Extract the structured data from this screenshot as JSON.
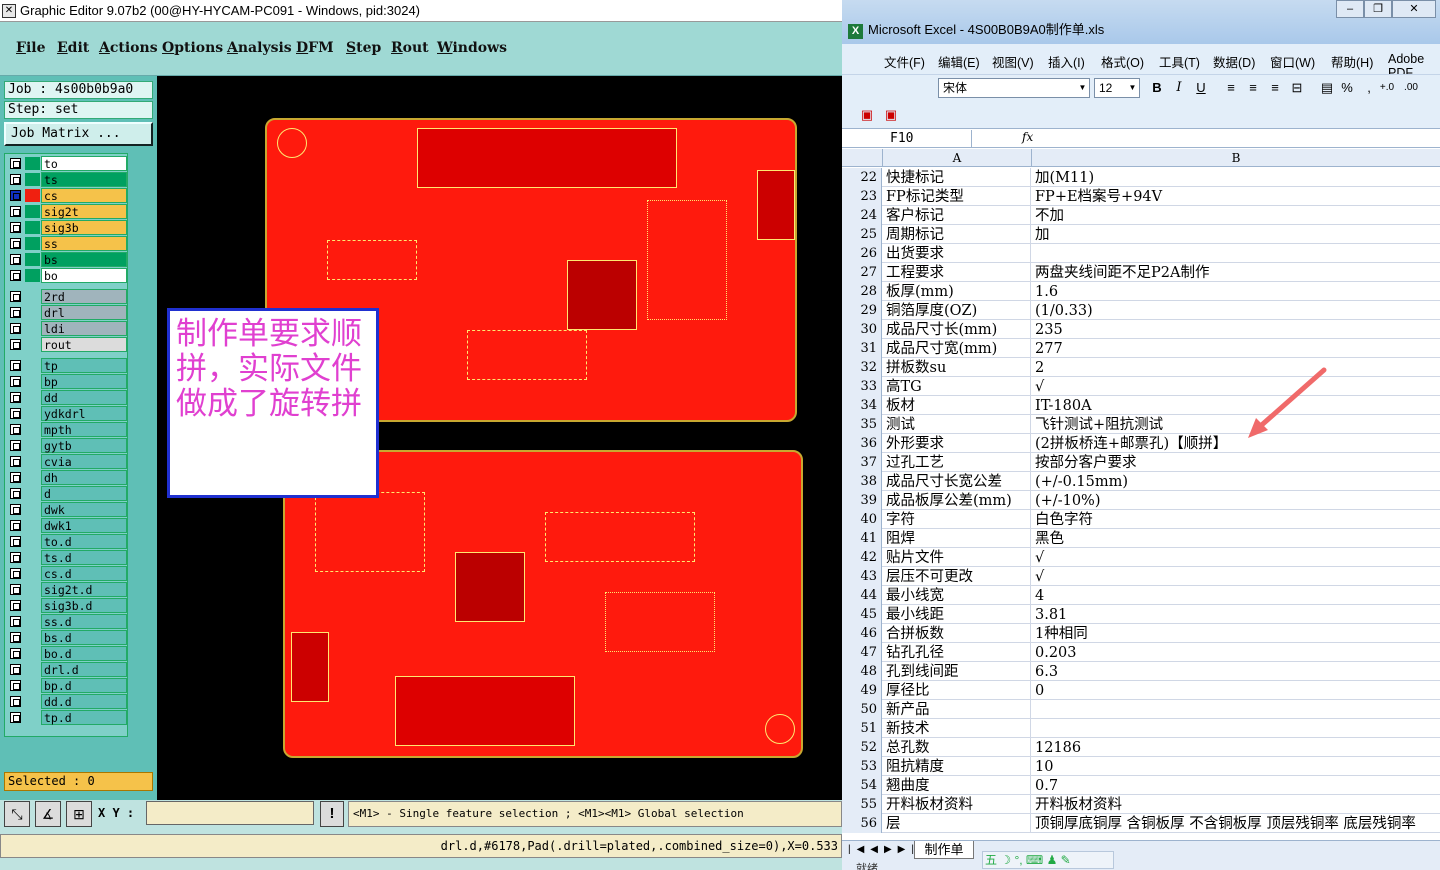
{
  "ge": {
    "title": "Graphic Editor 9.07b2 (00@HY-HYCAM-PC091 - Windows, pid:3024)",
    "menu": [
      "File",
      "Edit",
      "Actions",
      "Options",
      "Analysis",
      "DFM",
      "Step",
      "Rout",
      "Windows"
    ],
    "job": "Job : 4s00b0b9a0",
    "step": "Step: set",
    "job_matrix": "Job Matrix ...",
    "layers": [
      {
        "name": "to",
        "swatch": "#00a060",
        "fill": "#ffffff"
      },
      {
        "name": "ts",
        "swatch": "#00a060",
        "fill": "#00a060"
      },
      {
        "name": "cs",
        "swatch": "#f02010",
        "fill": "#f5c24a",
        "active": true
      },
      {
        "name": "sig2t",
        "swatch": "#00a060",
        "fill": "#f5c24a"
      },
      {
        "name": "sig3b",
        "swatch": "#00a060",
        "fill": "#f5c24a"
      },
      {
        "name": "ss",
        "swatch": "#00a060",
        "fill": "#f5c24a"
      },
      {
        "name": "bs",
        "swatch": "#00a060",
        "fill": "#00a060"
      },
      {
        "name": "bo",
        "swatch": "#00a060",
        "fill": "#ffffff"
      },
      {
        "name": "2rd",
        "swatch": "#7fd0c8",
        "fill": "#a0b4bc",
        "gap": true
      },
      {
        "name": "drl",
        "swatch": "#7fd0c8",
        "fill": "#a0b4bc"
      },
      {
        "name": "ldi",
        "swatch": "#7fd0c8",
        "fill": "#a0b4bc"
      },
      {
        "name": "rout",
        "swatch": "#7fd0c8",
        "fill": "#dcdcdc"
      },
      {
        "name": "tp",
        "swatch": "#7fd0c8",
        "fill": "#5fbfb6",
        "gap": true
      },
      {
        "name": "bp",
        "swatch": "#7fd0c8",
        "fill": "#5fbfb6"
      },
      {
        "name": "dd",
        "swatch": "#7fd0c8",
        "fill": "#5fbfb6"
      },
      {
        "name": "ydkdrl",
        "swatch": "#7fd0c8",
        "fill": "#5fbfb6"
      },
      {
        "name": "mpth",
        "swatch": "#7fd0c8",
        "fill": "#5fbfb6"
      },
      {
        "name": "gytb",
        "swatch": "#7fd0c8",
        "fill": "#5fbfb6"
      },
      {
        "name": "cvia",
        "swatch": "#7fd0c8",
        "fill": "#5fbfb6"
      },
      {
        "name": "dh",
        "swatch": "#7fd0c8",
        "fill": "#5fbfb6"
      },
      {
        "name": "d",
        "swatch": "#7fd0c8",
        "fill": "#5fbfb6"
      },
      {
        "name": "dwk",
        "swatch": "#7fd0c8",
        "fill": "#5fbfb6"
      },
      {
        "name": "dwk1",
        "swatch": "#7fd0c8",
        "fill": "#5fbfb6"
      },
      {
        "name": "to.d",
        "swatch": "#7fd0c8",
        "fill": "#5fbfb6"
      },
      {
        "name": "ts.d",
        "swatch": "#7fd0c8",
        "fill": "#5fbfb6"
      },
      {
        "name": "cs.d",
        "swatch": "#7fd0c8",
        "fill": "#5fbfb6"
      },
      {
        "name": "sig2t.d",
        "swatch": "#7fd0c8",
        "fill": "#5fbfb6"
      },
      {
        "name": "sig3b.d",
        "swatch": "#7fd0c8",
        "fill": "#5fbfb6"
      },
      {
        "name": "ss.d",
        "swatch": "#7fd0c8",
        "fill": "#5fbfb6"
      },
      {
        "name": "bs.d",
        "swatch": "#7fd0c8",
        "fill": "#5fbfb6"
      },
      {
        "name": "bo.d",
        "swatch": "#7fd0c8",
        "fill": "#5fbfb6"
      },
      {
        "name": "drl.d",
        "swatch": "#7fd0c8",
        "fill": "#5fbfb6"
      },
      {
        "name": "bp.d",
        "swatch": "#7fd0c8",
        "fill": "#5fbfb6"
      },
      {
        "name": "dd.d",
        "swatch": "#7fd0c8",
        "fill": "#5fbfb6"
      },
      {
        "name": "tp.d",
        "swatch": "#7fd0c8",
        "fill": "#5fbfb6"
      }
    ],
    "selected": "Selected : 0",
    "note": "制作单要求顺拼，实际文件做成了旋转拼",
    "xy_label": "X Y :",
    "xy_value": "",
    "help_label": "!",
    "hint": "<M1> - Single feature selection ; <M1><M1> Global selection",
    "status": "drl.d,#6178,Pad(.drill=plated,.combined_size=0),X=0.533"
  },
  "xl": {
    "title": "Microsoft Excel - 4S00B0B9A0制作单.xls",
    "menu": [
      "文件(F)",
      "编辑(E)",
      "视图(V)",
      "插入(I)",
      "格式(O)",
      "工具(T)",
      "数据(D)",
      "窗口(W)",
      "帮助(H)",
      "Adobe PDF"
    ],
    "font": "宋体",
    "size": "12",
    "namebox": "F10",
    "fx": "fx",
    "col_a": "A",
    "col_b": "B",
    "rows": [
      {
        "n": "22",
        "a": "快捷标记",
        "b": "加(M11)"
      },
      {
        "n": "23",
        "a": "FP标记类型",
        "b": "FP+E档案号+94V"
      },
      {
        "n": "24",
        "a": "客户标记",
        "b": "不加"
      },
      {
        "n": "25",
        "a": "周期标记",
        "b": "加"
      },
      {
        "n": "26",
        "a": "出货要求",
        "b": ""
      },
      {
        "n": "27",
        "a": "工程要求",
        "b": "两盘夹线间距不足P2A制作"
      },
      {
        "n": "28",
        "a": "板厚(mm)",
        "b": "1.6"
      },
      {
        "n": "29",
        "a": "铜箔厚度(OZ)",
        "b": "(1/0.33)"
      },
      {
        "n": "30",
        "a": "成品尺寸长(mm)",
        "b": "235"
      },
      {
        "n": "31",
        "a": "成品尺寸宽(mm)",
        "b": "277"
      },
      {
        "n": "32",
        "a": "拼板数su",
        "b": "2"
      },
      {
        "n": "33",
        "a": "高TG",
        "b": "√"
      },
      {
        "n": "34",
        "a": "板材",
        "b": "IT-180A"
      },
      {
        "n": "35",
        "a": "测试",
        "b": "飞针测试+阻抗测试"
      },
      {
        "n": "36",
        "a": "外形要求",
        "b": "(2拼板桥连+邮票孔)【顺拼】"
      },
      {
        "n": "37",
        "a": "过孔工艺",
        "b": "按部分客户要求"
      },
      {
        "n": "38",
        "a": "成品尺寸长宽公差",
        "b": "(+/-0.15mm)"
      },
      {
        "n": "39",
        "a": "成品板厚公差(mm)",
        "b": "(+/-10%)"
      },
      {
        "n": "40",
        "a": "字符",
        "b": "白色字符"
      },
      {
        "n": "41",
        "a": "阻焊",
        "b": "黑色"
      },
      {
        "n": "42",
        "a": "贴片文件",
        "b": "√"
      },
      {
        "n": "43",
        "a": "层压不可更改",
        "b": "√"
      },
      {
        "n": "44",
        "a": "最小线宽",
        "b": "4"
      },
      {
        "n": "45",
        "a": "最小线距",
        "b": "3.81"
      },
      {
        "n": "46",
        "a": "合拼板数",
        "b": "1种相同"
      },
      {
        "n": "47",
        "a": "钻孔孔径",
        "b": "0.203"
      },
      {
        "n": "48",
        "a": "孔到线间距",
        "b": "6.3"
      },
      {
        "n": "49",
        "a": "厚径比",
        "b": "0"
      },
      {
        "n": "50",
        "a": "新产品",
        "b": ""
      },
      {
        "n": "51",
        "a": "新技术",
        "b": ""
      },
      {
        "n": "52",
        "a": "总孔数",
        "b": "12186"
      },
      {
        "n": "53",
        "a": "阻抗精度",
        "b": "10"
      },
      {
        "n": "54",
        "a": "翘曲度",
        "b": "0.7"
      },
      {
        "n": "55",
        "a": "开料板材资料",
        "b": "开料板材资料"
      },
      {
        "n": "56",
        "a": "层",
        "b": "顶铜厚底铜厚 含铜板厚 不含铜板厚 顶层残铜率 底层残铜率"
      }
    ],
    "sheet_tab": "制作单",
    "ime": "五",
    "status_bar": "就绪"
  }
}
